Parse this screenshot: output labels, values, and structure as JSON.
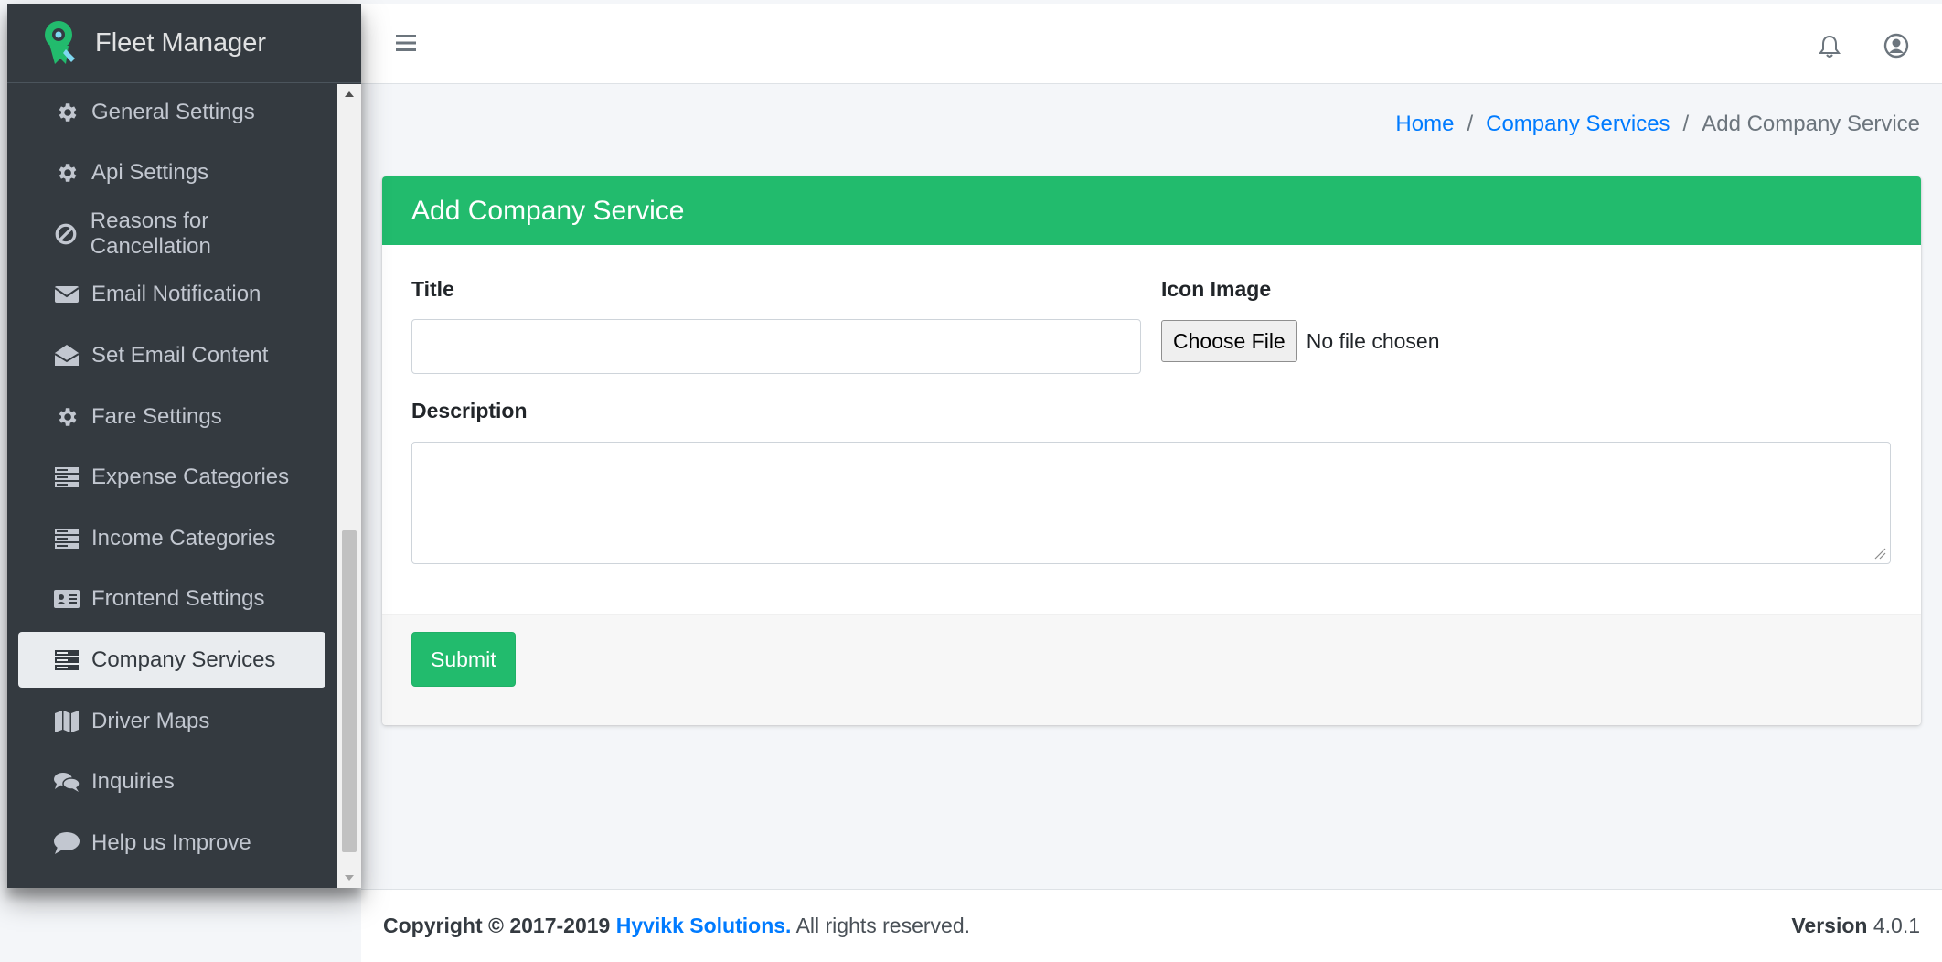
{
  "sidebar": {
    "brand": "Fleet Manager",
    "items": [
      {
        "label": "General Settings",
        "icon": "gear-icon"
      },
      {
        "label": "Api Settings",
        "icon": "gear-icon"
      },
      {
        "label": "Reasons for Cancellation",
        "icon": "ban-icon"
      },
      {
        "label": "Email Notification",
        "icon": "envelope-icon"
      },
      {
        "label": "Set Email Content",
        "icon": "envelope-open-icon"
      },
      {
        "label": "Fare Settings",
        "icon": "gear-icon"
      },
      {
        "label": "Expense Categories",
        "icon": "server-icon"
      },
      {
        "label": "Income Categories",
        "icon": "server-icon"
      },
      {
        "label": "Frontend Settings",
        "icon": "id-card-icon"
      },
      {
        "label": "Company Services",
        "icon": "server-icon",
        "active": true
      },
      {
        "label": "Driver Maps",
        "icon": "map-icon"
      },
      {
        "label": "Inquiries",
        "icon": "comments-icon"
      },
      {
        "label": "Help us Improve",
        "icon": "comment-icon"
      }
    ]
  },
  "breadcrumb": {
    "home": "Home",
    "parent": "Company Services",
    "separator": "/",
    "current": "Add Company Service"
  },
  "form": {
    "header": "Add Company Service",
    "title_label": "Title",
    "title_value": "",
    "icon_label": "Icon Image",
    "file_button": "Choose File",
    "file_status": "No file chosen",
    "description_label": "Description",
    "description_value": "",
    "submit_label": "Submit"
  },
  "footer": {
    "copyright_prefix": "Copyright © 2017-2019",
    "company": "Hyvikk Solutions.",
    "rights": "All rights reserved.",
    "version_label": "Version",
    "version_value": "4.0.1"
  },
  "colors": {
    "sidebar_bg": "#343a40",
    "accent_green": "#22bb6d",
    "link_blue": "#007bff",
    "page_bg": "#f4f6f9"
  }
}
